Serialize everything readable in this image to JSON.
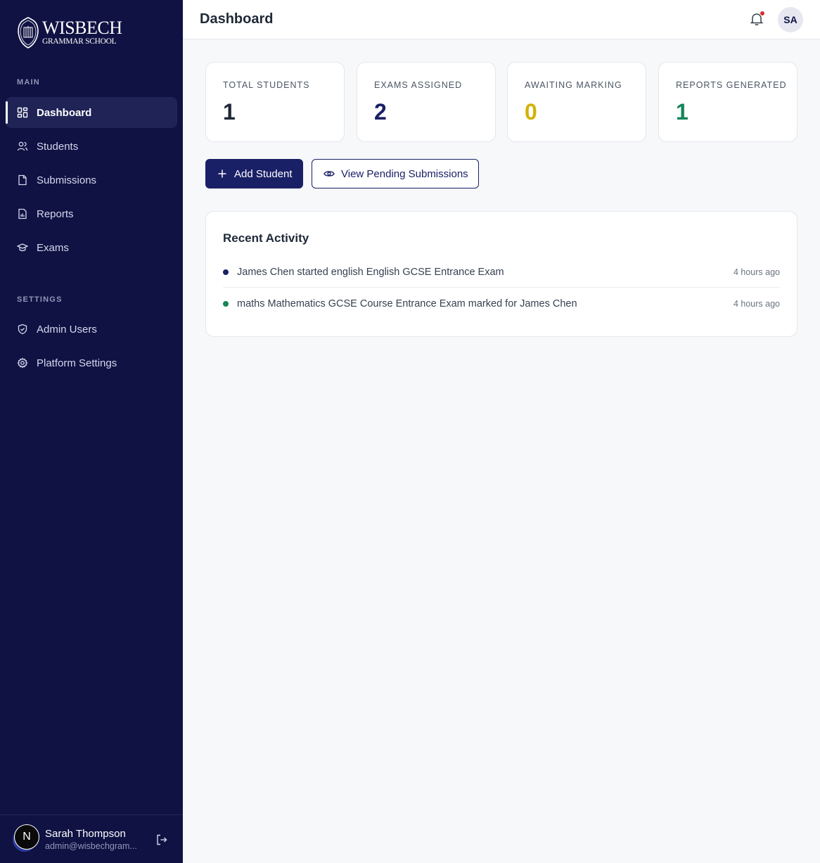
{
  "brand": {
    "name": "WISBECH",
    "subtitle": "GRAMMAR SCHOOL"
  },
  "sidebar": {
    "main_label": "MAIN",
    "settings_label": "SETTINGS",
    "main_items": [
      {
        "label": "Dashboard",
        "icon": "dashboard-icon",
        "active": true
      },
      {
        "label": "Students",
        "icon": "users-icon"
      },
      {
        "label": "Submissions",
        "icon": "file-icon"
      },
      {
        "label": "Reports",
        "icon": "report-icon"
      },
      {
        "label": "Exams",
        "icon": "graduation-cap-icon"
      }
    ],
    "settings_items": [
      {
        "label": "Admin Users",
        "icon": "shield-check-icon"
      },
      {
        "label": "Platform Settings",
        "icon": "gear-icon"
      }
    ],
    "user": {
      "avatar_letter": "N",
      "name": "Sarah Thompson",
      "email": "admin@wisbechgram..."
    }
  },
  "header": {
    "title": "Dashboard",
    "avatar_initials": "SA"
  },
  "stats": [
    {
      "label": "TOTAL STUDENTS",
      "value": "1",
      "color": "#1f2937"
    },
    {
      "label": "EXAMS ASSIGNED",
      "value": "2",
      "color": "#1a2066"
    },
    {
      "label": "AWAITING MARKING",
      "value": "0",
      "color": "#d4b106"
    },
    {
      "label": "REPORTS GENERATED",
      "value": "1",
      "color": "#15855a"
    }
  ],
  "actions": {
    "add_student": "Add Student",
    "view_pending": "View Pending Submissions"
  },
  "activity": {
    "title": "Recent Activity",
    "items": [
      {
        "text": "James Chen started english English GCSE Entrance Exam",
        "time": "4 hours ago",
        "dot_color": "#1a2066"
      },
      {
        "text": "maths Mathematics GCSE Course Entrance Exam marked for James Chen",
        "time": "4 hours ago",
        "dot_color": "#15855a"
      }
    ]
  },
  "colors": {
    "sidebar_bg": "#0f1242",
    "primary": "#1a2066",
    "notification": "#d32f2f"
  }
}
